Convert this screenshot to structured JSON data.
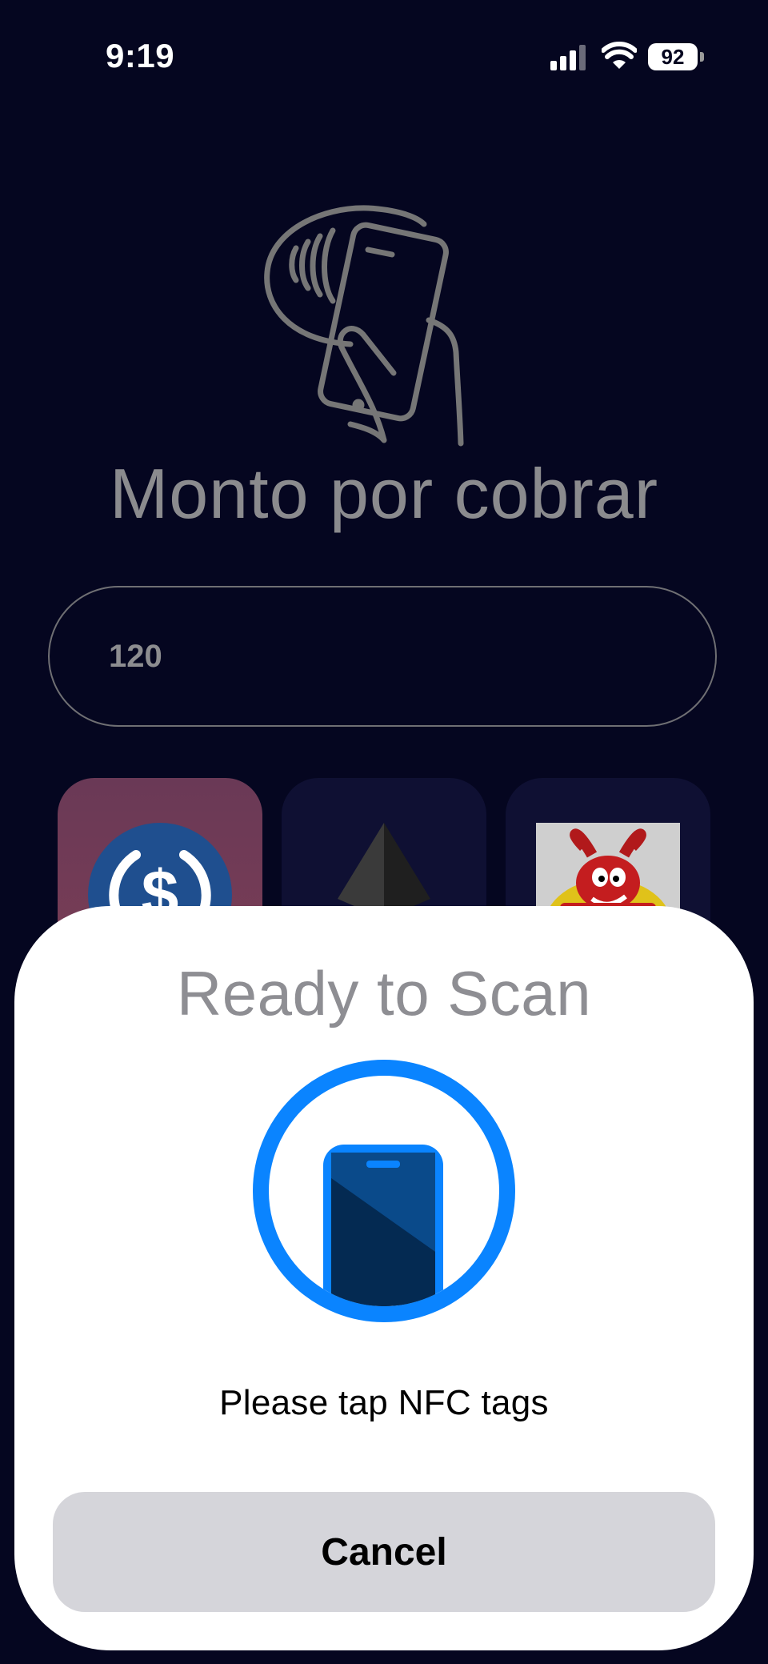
{
  "status_bar": {
    "time": "9:19",
    "battery": "92"
  },
  "main": {
    "title": "Monto por cobrar",
    "amount_value": "120"
  },
  "tokens": [
    {
      "icon": "usdc-coin-icon"
    },
    {
      "icon": "ethereum-icon"
    },
    {
      "icon": "mascot-logo-icon"
    }
  ],
  "nfc_sheet": {
    "title": "Ready to Scan",
    "message": "Please tap NFC tags",
    "cancel_label": "Cancel",
    "accent_color": "#0A84FF"
  }
}
